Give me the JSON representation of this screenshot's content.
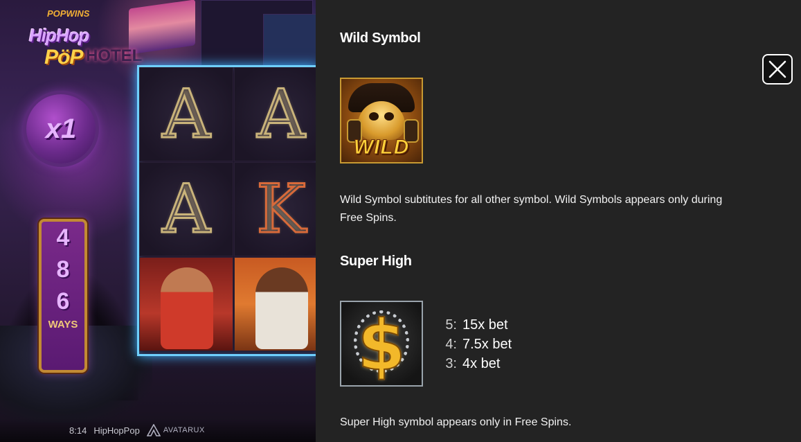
{
  "game": {
    "provider_logo": "POPWINS",
    "logo_line1": "HipHop",
    "logo_line2": "PöP",
    "neon_sign": "HOTEL",
    "multiplier": "x1",
    "ways": {
      "digits": [
        "4",
        "8",
        "6"
      ],
      "label": "WAYS"
    },
    "reels": {
      "row1": [
        "A",
        "A"
      ],
      "row2": [
        "A",
        "K"
      ],
      "row3": [
        "rapper-character-symbol",
        "dj-character-symbol"
      ]
    },
    "hud": {
      "time": "8:14",
      "game_name": "HipHopPop",
      "studio": "AVATARUX"
    }
  },
  "paytable": {
    "wild": {
      "title": "Wild Symbol",
      "symbol_text": "WILD",
      "description": "Wild Symbol subtitutes for all other symbol. Wild Symbols appears only during Free Spins."
    },
    "super_high": {
      "title": "Super High",
      "symbol_icon": "gold-dollar-chain-icon",
      "payouts": [
        {
          "count": "5:",
          "value": "15x bet"
        },
        {
          "count": "4:",
          "value": "7.5x bet"
        },
        {
          "count": "3:",
          "value": "4x bet"
        }
      ],
      "description": "Super High symbol appears only in Free Spins."
    },
    "close_icon": "close-icon"
  },
  "colors": {
    "panel_bg": "#232323",
    "reel_glow": "#6fd0ff",
    "wild_gold": "#ffd23a",
    "ways_frame": "#c28a34"
  }
}
